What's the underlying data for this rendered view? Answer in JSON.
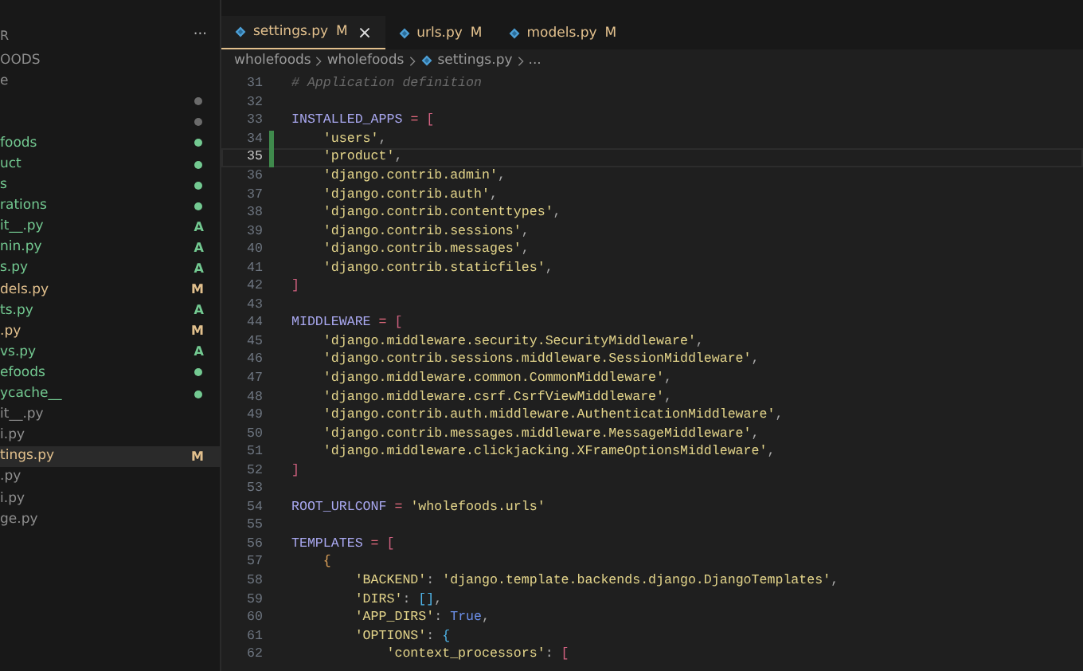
{
  "sidebar": {
    "header": "R",
    "more": "···",
    "items": [
      {
        "label": "OODS",
        "color": "#8e8e8e",
        "selected": false
      },
      {
        "label": "e",
        "color": "#8e8e8e",
        "selected": false
      },
      {
        "color": "#6b6b6b",
        "dot": true,
        "selected": false
      },
      {
        "color": "#6b6b6b",
        "dot": true,
        "selected": false
      },
      {
        "label": "foods",
        "color": "#73c991",
        "dot": true,
        "selected": false
      },
      {
        "label": "uct",
        "color": "#73c991",
        "dot": true,
        "selected": false
      },
      {
        "label": "s",
        "color": "#73c991",
        "dot": true,
        "selected": false
      },
      {
        "label": "rations",
        "color": "#73c991",
        "dot": true,
        "selected": false
      },
      {
        "label": "it__.py",
        "color": "#73c991",
        "badge": "A",
        "selected": false
      },
      {
        "label": "nin.py",
        "color": "#73c991",
        "badge": "A",
        "selected": false
      },
      {
        "label": "s.py",
        "color": "#73c991",
        "badge": "A",
        "selected": false
      },
      {
        "label": "dels.py",
        "color": "#e2c08d",
        "badge": "M",
        "selected": false
      },
      {
        "label": "ts.py",
        "color": "#73c991",
        "badge": "A",
        "selected": false
      },
      {
        "label": ".py",
        "color": "#e2c08d",
        "badge": "M",
        "selected": false
      },
      {
        "label": "vs.py",
        "color": "#73c991",
        "badge": "A",
        "selected": false
      },
      {
        "label": "efoods",
        "color": "#73c991",
        "dot": true,
        "selected": false
      },
      {
        "label": "ycache__",
        "color": "#73c991",
        "dot": true,
        "selected": false
      },
      {
        "label": "it__.py",
        "color": "#8e8e8e",
        "selected": false
      },
      {
        "label": "i.py",
        "color": "#8e8e8e",
        "selected": false
      },
      {
        "label": "tings.py",
        "color": "#e2c08d",
        "badge": "M",
        "selected": true
      },
      {
        "label": ".py",
        "color": "#8e8e8e",
        "selected": false
      },
      {
        "label": "i.py",
        "color": "#8e8e8e",
        "selected": false
      },
      {
        "label": "ge.py",
        "color": "#8e8e8e",
        "selected": false
      }
    ]
  },
  "tabs": [
    {
      "label": "settings.py",
      "badge": "M",
      "close": "×",
      "selected": true
    },
    {
      "label": "urls.py",
      "badge": "M",
      "selected": false
    },
    {
      "label": "models.py",
      "badge": "M",
      "selected": false
    }
  ],
  "breadcrumb": [
    {
      "label": "wholefoods",
      "kind": "folder"
    },
    {
      "label": "wholefoods",
      "kind": "folder"
    },
    {
      "label": "settings.py",
      "kind": "file"
    },
    {
      "label": "...",
      "kind": "more"
    }
  ],
  "editor": {
    "lines": [
      {
        "n": "31",
        "kind": "top",
        "current": false,
        "changed": false,
        "tokens": [
          {
            "t": "# Application definition",
            "kind": "comment"
          }
        ]
      },
      {
        "n": "32",
        "current": false,
        "changed": false
      },
      {
        "n": "33",
        "kind": "top",
        "current": false,
        "changed": false,
        "tokens": [
          {
            "t": "INSTALLED_APPS",
            "kind": "name"
          },
          {
            "t": " = ",
            "kind": "operator"
          },
          {
            "t": "[",
            "kind": "bracket"
          }
        ]
      },
      {
        "n": "34",
        "kind": "inner",
        "current": false,
        "changed": true,
        "tokens": [
          {
            "t": "'users'",
            "kind": "string"
          },
          {
            "t": ",",
            "kind": "punct"
          }
        ]
      },
      {
        "n": "35",
        "kind": "inner",
        "current": true,
        "changed": true,
        "tokens": [
          {
            "t": "'product'",
            "kind": "string"
          },
          {
            "t": ",",
            "kind": "punct"
          }
        ]
      },
      {
        "n": "36",
        "kind": "inner",
        "current": false,
        "changed": false,
        "tokens": [
          {
            "t": "'django.contrib.admin'",
            "kind": "string"
          },
          {
            "t": ",",
            "kind": "punct"
          }
        ]
      },
      {
        "n": "37",
        "kind": "inner",
        "current": false,
        "changed": false,
        "tokens": [
          {
            "t": "'django.contrib.auth'",
            "kind": "string"
          },
          {
            "t": ",",
            "kind": "punct"
          }
        ]
      },
      {
        "n": "38",
        "kind": "inner",
        "current": false,
        "changed": false,
        "tokens": [
          {
            "t": "'django.contrib.contenttypes'",
            "kind": "string"
          },
          {
            "t": ",",
            "kind": "punct"
          }
        ]
      },
      {
        "n": "39",
        "kind": "inner",
        "current": false,
        "changed": false,
        "tokens": [
          {
            "t": "'django.contrib.sessions'",
            "kind": "string"
          },
          {
            "t": ",",
            "kind": "punct"
          }
        ]
      },
      {
        "n": "40",
        "kind": "inner",
        "current": false,
        "changed": false,
        "tokens": [
          {
            "t": "'django.contrib.messages'",
            "kind": "string"
          },
          {
            "t": ",",
            "kind": "punct"
          }
        ]
      },
      {
        "n": "41",
        "kind": "inner",
        "current": false,
        "changed": false,
        "tokens": [
          {
            "t": "'django.contrib.staticfiles'",
            "kind": "string"
          },
          {
            "t": ",",
            "kind": "punct"
          }
        ]
      },
      {
        "n": "42",
        "kind": "top",
        "current": false,
        "changed": false,
        "tokens": [
          {
            "t": "]",
            "kind": "bracket"
          }
        ]
      },
      {
        "n": "43",
        "current": false,
        "changed": false
      },
      {
        "n": "44",
        "kind": "top",
        "current": false,
        "changed": false,
        "tokens": [
          {
            "t": "MIDDLEWARE",
            "kind": "name"
          },
          {
            "t": " = ",
            "kind": "operator"
          },
          {
            "t": "[",
            "kind": "bracket"
          }
        ]
      },
      {
        "n": "45",
        "kind": "inner",
        "current": false,
        "changed": false,
        "tokens": [
          {
            "t": "'django.middleware.security.SecurityMiddleware'",
            "kind": "string"
          },
          {
            "t": ",",
            "kind": "punct"
          }
        ]
      },
      {
        "n": "46",
        "kind": "inner",
        "current": false,
        "changed": false,
        "tokens": [
          {
            "t": "'django.contrib.sessions.middleware.SessionMiddleware'",
            "kind": "string"
          },
          {
            "t": ",",
            "kind": "punct"
          }
        ]
      },
      {
        "n": "47",
        "kind": "inner",
        "current": false,
        "changed": false,
        "tokens": [
          {
            "t": "'django.middleware.common.CommonMiddleware'",
            "kind": "string"
          },
          {
            "t": ",",
            "kind": "punct"
          }
        ]
      },
      {
        "n": "48",
        "kind": "inner",
        "current": false,
        "changed": false,
        "tokens": [
          {
            "t": "'django.middleware.csrf.CsrfViewMiddleware'",
            "kind": "string"
          },
          {
            "t": ",",
            "kind": "punct"
          }
        ]
      },
      {
        "n": "49",
        "kind": "inner",
        "current": false,
        "changed": false,
        "tokens": [
          {
            "t": "'django.contrib.auth.middleware.AuthenticationMiddleware'",
            "kind": "string"
          },
          {
            "t": ",",
            "kind": "punct"
          }
        ]
      },
      {
        "n": "50",
        "kind": "inner",
        "current": false,
        "changed": false,
        "tokens": [
          {
            "t": "'django.contrib.messages.middleware.MessageMiddleware'",
            "kind": "string"
          },
          {
            "t": ",",
            "kind": "punct"
          }
        ]
      },
      {
        "n": "51",
        "kind": "inner",
        "current": false,
        "changed": false,
        "tokens": [
          {
            "t": "'django.middleware.clickjacking.XFrameOptionsMiddleware'",
            "kind": "string"
          },
          {
            "t": ",",
            "kind": "punct"
          }
        ]
      },
      {
        "n": "52",
        "kind": "top",
        "current": false,
        "changed": false,
        "tokens": [
          {
            "t": "]",
            "kind": "bracket"
          }
        ]
      },
      {
        "n": "53",
        "current": false,
        "changed": false
      },
      {
        "n": "54",
        "kind": "top",
        "current": false,
        "changed": false,
        "tokens": [
          {
            "t": "ROOT_URLCONF",
            "kind": "name"
          },
          {
            "t": " = ",
            "kind": "operator"
          },
          {
            "t": "'wholefoods.urls'",
            "kind": "string"
          }
        ]
      },
      {
        "n": "55",
        "current": false,
        "changed": false
      },
      {
        "n": "56",
        "kind": "top",
        "current": false,
        "changed": false,
        "tokens": [
          {
            "t": "TEMPLATES",
            "kind": "name"
          },
          {
            "t": " = ",
            "kind": "operator"
          },
          {
            "t": "[",
            "kind": "bracket"
          }
        ]
      },
      {
        "n": "57",
        "kind": "inner",
        "current": false,
        "changed": false,
        "tokens": [
          {
            "t": "{",
            "kind": "brace"
          }
        ]
      },
      {
        "n": "58",
        "kind": "nested",
        "current": false,
        "changed": false,
        "tokens": [
          {
            "t": "'BACKEND'",
            "kind": "string"
          },
          {
            "t": ": ",
            "kind": "punct"
          },
          {
            "t": "'django.template.backends.django.DjangoTemplates'",
            "kind": "string"
          },
          {
            "t": ",",
            "kind": "punct"
          }
        ]
      },
      {
        "n": "59",
        "kind": "nested",
        "current": false,
        "changed": false,
        "tokens": [
          {
            "t": "'DIRS'",
            "kind": "string"
          },
          {
            "t": ": ",
            "kind": "punct"
          },
          {
            "t": "[]",
            "kind": "list"
          },
          {
            "t": ",",
            "kind": "punct"
          }
        ]
      },
      {
        "n": "60",
        "kind": "nested",
        "current": false,
        "changed": false,
        "tokens": [
          {
            "t": "'APP_DIRS'",
            "kind": "string"
          },
          {
            "t": ": ",
            "kind": "punct"
          },
          {
            "t": "True",
            "kind": "bool"
          },
          {
            "t": ",",
            "kind": "punct"
          }
        ]
      },
      {
        "n": "61",
        "kind": "nested",
        "current": false,
        "changed": false,
        "tokens": [
          {
            "t": "'OPTIONS'",
            "kind": "string"
          },
          {
            "t": ": ",
            "kind": "punct"
          },
          {
            "t": "{",
            "kind": "list"
          }
        ]
      },
      {
        "n": "62",
        "kind": "deep",
        "current": false,
        "changed": false,
        "tokens": [
          {
            "t": "'context_processors'",
            "kind": "string"
          },
          {
            "t": ": ",
            "kind": "punct"
          },
          {
            "t": "[",
            "kind": "bracket"
          }
        ]
      }
    ]
  }
}
